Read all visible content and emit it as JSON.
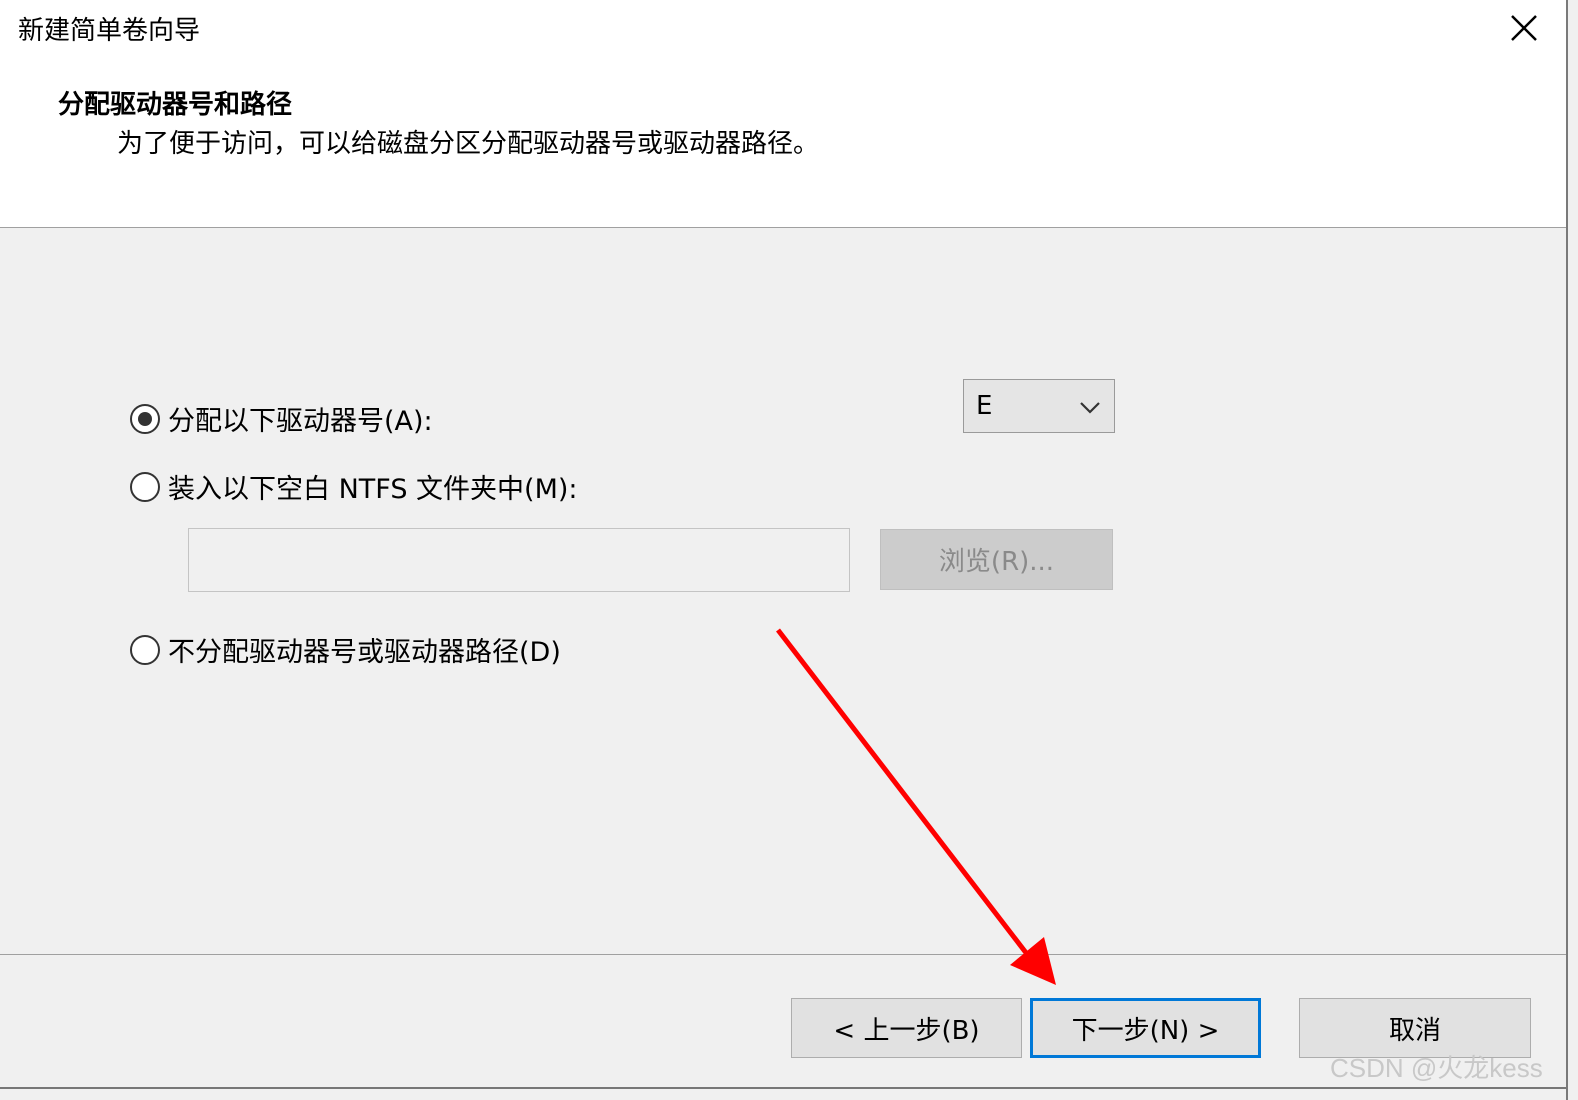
{
  "window": {
    "title": "新建简单卷向导",
    "close_icon": "close-icon"
  },
  "header": {
    "title": "分配驱动器号和路径",
    "subtitle": "为了便于访问，可以给磁盘分区分配驱动器号或驱动器路径。"
  },
  "options": {
    "assign_letter": {
      "label": "分配以下驱动器号(A):",
      "selected": true
    },
    "mount_folder": {
      "label": "装入以下空白 NTFS 文件夹中(M):",
      "selected": false
    },
    "no_assign": {
      "label": "不分配驱动器号或驱动器路径(D)",
      "selected": false
    }
  },
  "drive_letter": {
    "value": "E",
    "icon": "chevron-down-icon"
  },
  "folder_path": {
    "value": ""
  },
  "browse_button": {
    "label": "浏览(R)..."
  },
  "footer": {
    "back_label": "< 上一步(B)",
    "next_label": "下一步(N) >",
    "cancel_label": "取消"
  },
  "annotation": {
    "color": "#ff0000"
  },
  "watermark": {
    "text": "CSDN @火龙kess"
  }
}
